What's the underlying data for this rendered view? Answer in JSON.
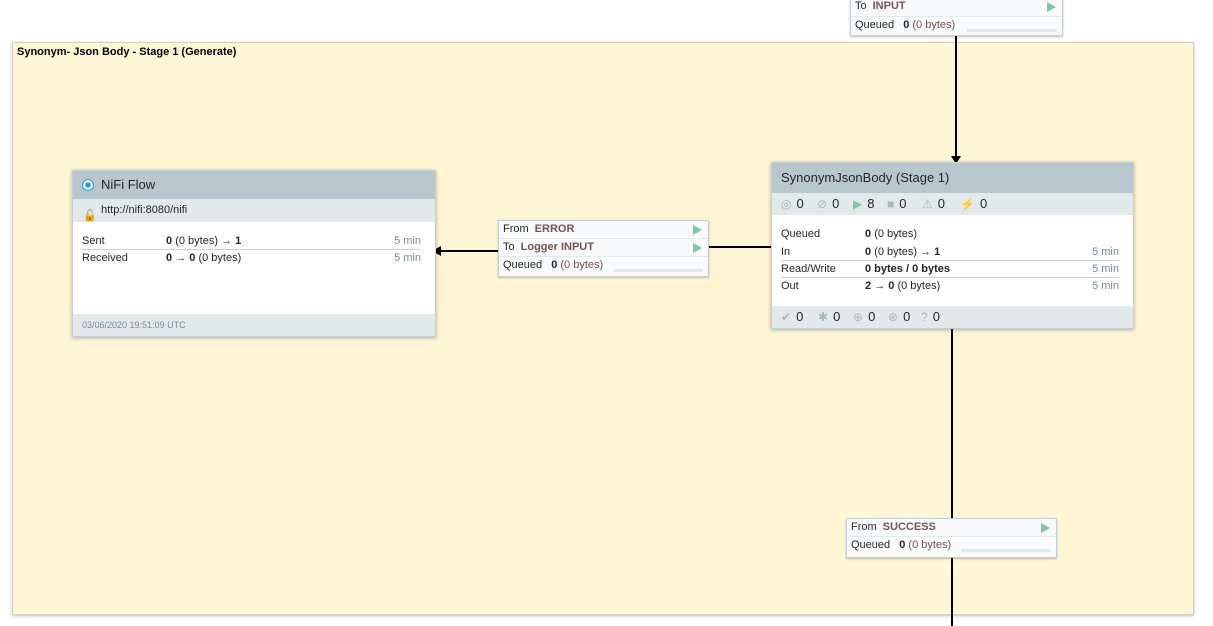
{
  "top_connection": {
    "to_label": "To",
    "to_value": "INPUT",
    "queued_label": "Queued",
    "queued_count": "0",
    "queued_size": "(0 bytes)"
  },
  "label": {
    "text": "Synonym- Json Body - Stage 1 (Generate)"
  },
  "remote_group": {
    "name": "NiFi Flow",
    "url": "http://nifi:8080/nifi",
    "sent_label": "Sent",
    "sent_count": "0",
    "sent_size": "(0 bytes)",
    "sent_arrow": "→",
    "sent_ports": "1",
    "sent_time": "5 min",
    "received_label": "Received",
    "received_count": "0",
    "received_arrow": "→",
    "received_ports": "0",
    "received_size": "(0 bytes)",
    "received_time": "5 min",
    "timestamp": "03/06/2020 19:51:09 UTC"
  },
  "error_connection": {
    "from_label": "From",
    "from_value": "ERROR",
    "to_label": "To",
    "to_value": "Logger INPUT",
    "queued_label": "Queued",
    "queued_count": "0",
    "queued_size": "(0 bytes)"
  },
  "process_group": {
    "name": "SynonymJsonBody (Stage 1)",
    "counts": {
      "transmitting": "0",
      "not_transmitting": "0",
      "running": "8",
      "stopped": "0",
      "invalid": "0",
      "disabled": "0"
    },
    "queued_label": "Queued",
    "queued_count": "0",
    "queued_size": "(0 bytes)",
    "in_label": "In",
    "in_count": "0",
    "in_size": "(0 bytes)",
    "in_arrow": "→",
    "in_ports": "1",
    "in_time": "5 min",
    "rw_label": "Read/Write",
    "rw_value": "0 bytes / 0 bytes",
    "rw_time": "5 min",
    "out_label": "Out",
    "out_ports": "2",
    "out_arrow": "→",
    "out_count": "0",
    "out_size": "(0 bytes)",
    "out_time": "5 min",
    "version": {
      "up_to_date": "0",
      "locally_modified": "0",
      "stale": "0",
      "modified_stale": "0",
      "sync_failure": "0"
    }
  },
  "success_connection": {
    "from_label": "From",
    "from_value": "SUCCESS",
    "queued_label": "Queued",
    "queued_count": "0",
    "queued_size": "(0 bytes)"
  },
  "colors": {
    "label_bg": "#fff6d6",
    "header_bg": "#b8c6cd",
    "play_green": "#7dc7a0",
    "value_brown": "#775351"
  }
}
